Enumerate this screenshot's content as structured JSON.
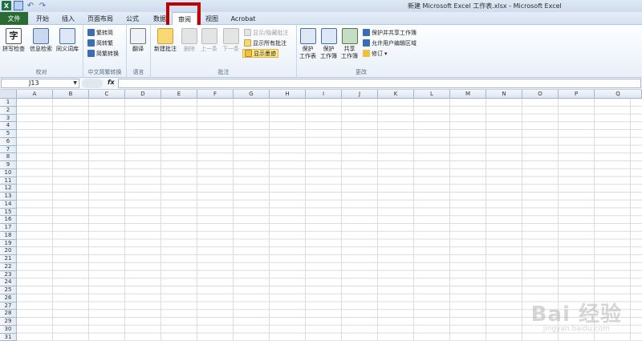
{
  "window": {
    "title": "新建 Microsoft Excel 工作表.xlsx - Microsoft Excel"
  },
  "menu": {
    "file": "文件",
    "tabs": [
      "开始",
      "插入",
      "页面布局",
      "公式",
      "数据",
      "审阅",
      "视图",
      "Acrobat"
    ],
    "active": "审阅"
  },
  "ribbon": {
    "proofing": {
      "label": "校对",
      "spell": "拼写检查",
      "research": "信息检索",
      "thesaurus": "同义词库"
    },
    "chinese": {
      "label": "中文简繁转换",
      "to_trad": "繁转简",
      "to_simp": "简转繁",
      "convert": "简繁转换"
    },
    "language": {
      "label": "语言",
      "translate": "翻译"
    },
    "comments": {
      "label": "批注",
      "new": "新建批注",
      "delete": "删除",
      "prev": "上一条",
      "next": "下一条",
      "show_hide": "显示/隐藏批注",
      "show_all": "显示所有批注",
      "show_ink": "显示墨迹"
    },
    "changes": {
      "label": "更改",
      "protect_sheet": "保护\n工作表",
      "protect_book": "保护\n工作簿",
      "share": "共享\n工作簿",
      "protect_share": "保护并共享工作簿",
      "allow_edit": "允许用户编辑区域",
      "track": "修订"
    }
  },
  "formula_bar": {
    "name_box": "J13",
    "fx": "fx",
    "value": ""
  },
  "columns": [
    "A",
    "B",
    "C",
    "D",
    "E",
    "F",
    "G",
    "H",
    "I",
    "J",
    "K",
    "L",
    "M",
    "N",
    "O",
    "P",
    "Q"
  ],
  "rows": [
    "1",
    "2",
    "3",
    "4",
    "5",
    "6",
    "7",
    "8",
    "9",
    "10",
    "11",
    "12",
    "13",
    "14",
    "15",
    "16",
    "17",
    "18",
    "19",
    "20",
    "21",
    "22",
    "23",
    "24",
    "25",
    "26",
    "27",
    "28",
    "29",
    "30",
    "31"
  ],
  "watermark": {
    "main": "Bai 经验",
    "sub": "jingyan.baidu.com"
  },
  "colors": {
    "file_tab": "#2a6b33",
    "highlight": "#c00000"
  }
}
